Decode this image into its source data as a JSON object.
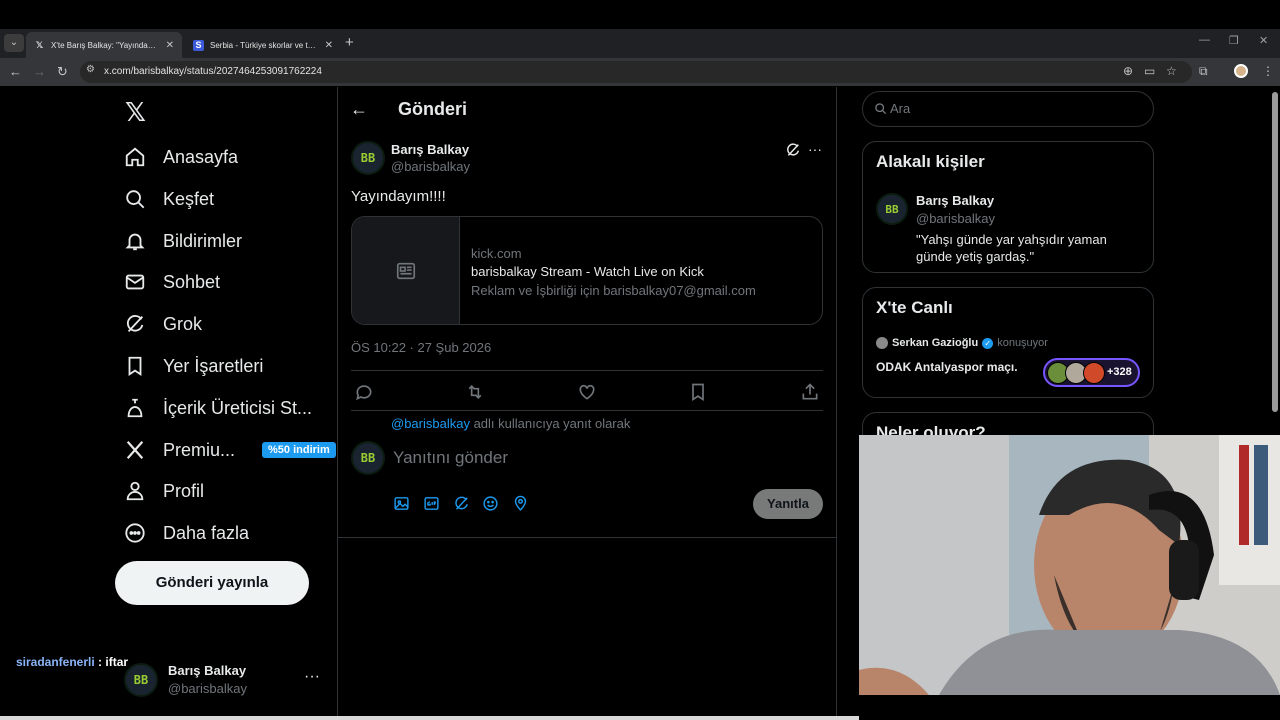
{
  "browser": {
    "tabs": [
      {
        "title": "X'te Barış Balkay: \"Yayındayım!!!!\"",
        "favicon": "x-logo-icon",
        "active": true
      },
      {
        "title": "Serbia - Türkiye skorlar ve tahminler",
        "favicon": "sofascore-icon",
        "active": false
      }
    ],
    "url": "x.com/barisbalkay/status/2027464253091762224"
  },
  "sidebar": {
    "items": [
      {
        "label": "Anasayfa",
        "icon": "home-icon"
      },
      {
        "label": "Keşfet",
        "icon": "search-icon"
      },
      {
        "label": "Bildirimler",
        "icon": "bell-icon"
      },
      {
        "label": "Sohbet",
        "icon": "mail-icon"
      },
      {
        "label": "Grok",
        "icon": "grok-icon"
      },
      {
        "label": "Yer İşaretleri",
        "icon": "bookmark-icon"
      },
      {
        "label": "İçerik Üreticisi St...",
        "icon": "creator-studio-icon"
      },
      {
        "label": "Premiu...",
        "icon": "x-premium-icon",
        "badge": "%50 indirim"
      },
      {
        "label": "Profil",
        "icon": "person-icon"
      },
      {
        "label": "Daha fazla",
        "icon": "more-circle-icon"
      }
    ],
    "post_button": "Gönderi yayınla",
    "account": {
      "name": "Barış Balkay",
      "handle": "@barisbalkay",
      "avatar_text": "BB"
    }
  },
  "chat_overlay": {
    "user": "siradanfenerli",
    "message": " : iftar"
  },
  "main": {
    "title": "Gönderi",
    "post": {
      "author_name": "Barış Balkay",
      "author_handle": "@barisbalkay",
      "text": "Yayındayım!!!!",
      "card": {
        "domain": "kick.com",
        "title": "barisbalkay Stream - Watch Live on Kick",
        "description": "Reklam ve İşbirliği için barisbalkay07@gmail.com"
      },
      "timestamp": "ÖS 10:22 · 27 Şub 2026"
    },
    "reply": {
      "mention": "@barisbalkay",
      "reply_to_suffix": " adlı kullanıcıya yanıt olarak",
      "placeholder": "Yanıtını gönder",
      "button": "Yanıtla"
    }
  },
  "right": {
    "search_placeholder": "Ara",
    "relevant": {
      "title": "Alakalı kişiler",
      "name": "Barış Balkay",
      "handle": "@barisbalkay",
      "bio": "\"Yahşı günde yar yahşıdır yaman günde yetiş gardaş.\""
    },
    "live": {
      "title": "X'te Canlı",
      "host": "Serkan Gazioğlu",
      "state": "konuşuyor",
      "stream_title": "ODAK Antalyaspor maçı.",
      "count": "+328"
    },
    "next_title": "Neler oluyor?"
  },
  "colors": {
    "accent": "#1d9bf0",
    "live_border": "#7856ff",
    "background": "#000000",
    "border": "#2f3336"
  }
}
